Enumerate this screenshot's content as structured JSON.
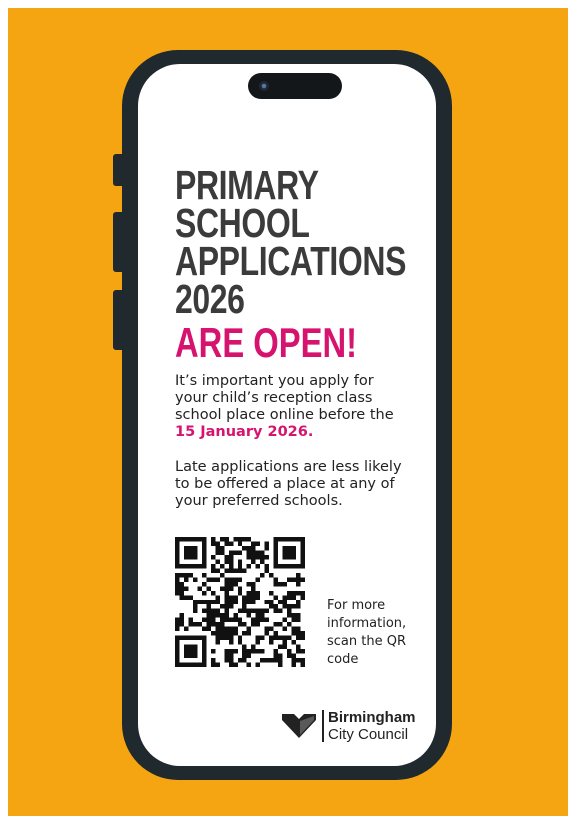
{
  "headline": {
    "line1": "PRIMARY",
    "line2": "SCHOOL",
    "line3": "APPLICATIONS",
    "line4": "2026",
    "highlight": "ARE OPEN!"
  },
  "intro": {
    "text": "It’s important you apply for your child’s reception class school place online before the ",
    "date": "15 January 2026."
  },
  "warning": "Late applications are less likely to be offered a place at any of your preferred schools.",
  "qr": {
    "caption": "For more information, scan the QR code"
  },
  "logo": {
    "line1": "Birmingham",
    "line2": "City Council"
  },
  "colors": {
    "background": "#f5a511",
    "phone": "#20292e",
    "accent": "#d6136f",
    "headline": "#3b3b3b"
  },
  "icons": {
    "logo_mark": "heart-shield-icon",
    "camera": "camera-icon"
  }
}
